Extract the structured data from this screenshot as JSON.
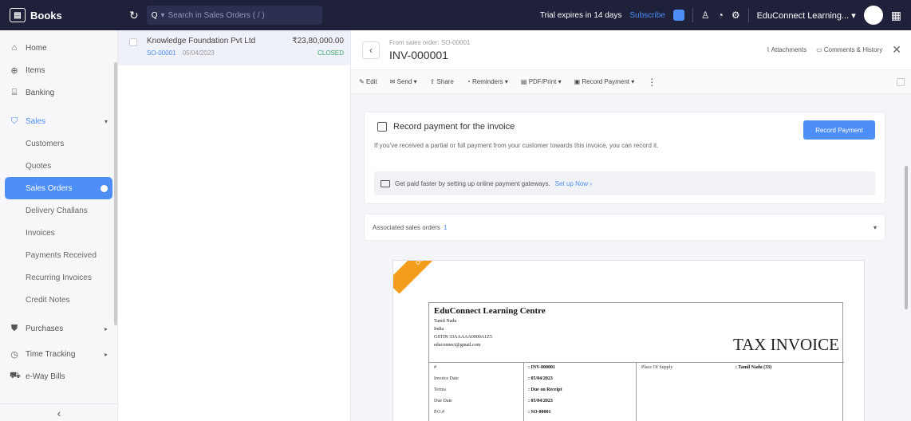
{
  "topbar": {
    "brand": "Books",
    "search_scope": "Q",
    "search_placeholder": "Search in Sales Orders ( / )",
    "trial_text": "Trial expires in 14 days",
    "subscribe": "Subscribe",
    "org_name": "EduConnect Learning..."
  },
  "sidebar": {
    "items": [
      {
        "label": "Home"
      },
      {
        "label": "Items"
      },
      {
        "label": "Banking"
      }
    ],
    "sales": {
      "label": "Sales"
    },
    "sales_sub": [
      {
        "label": "Customers"
      },
      {
        "label": "Quotes"
      },
      {
        "label": "Sales Orders"
      },
      {
        "label": "Delivery Challans"
      },
      {
        "label": "Invoices"
      },
      {
        "label": "Payments Received"
      },
      {
        "label": "Recurring Invoices"
      },
      {
        "label": "Credit Notes"
      }
    ],
    "bottom": [
      {
        "label": "Purchases"
      },
      {
        "label": "Time Tracking"
      },
      {
        "label": "e-Way Bills"
      }
    ]
  },
  "list": {
    "rows": [
      {
        "name": "Knowledge Foundation Pvt Ltd",
        "order_no": "SO-00001",
        "date": "05/04/2023",
        "amount": "₹23,80,000.00",
        "status": "CLOSED"
      }
    ]
  },
  "detail": {
    "from_so": "From sales order: SO-00001",
    "invoice_no": "INV-000001",
    "attachments": "Attachments",
    "comments": "Comments & History",
    "toolbar": {
      "edit": "Edit",
      "send": "Send ▾",
      "share": "Share",
      "reminders": "Reminders ▾",
      "pdf_print": "PDF/Print ▾",
      "record_payment": "Record Payment ▾"
    },
    "pay_card": {
      "title": "Record payment for the invoice",
      "desc": "If you've received a partial or full payment from your customer towards this invoice, you can record it.",
      "button": "Record Payment",
      "gateway_text": "Get paid faster by setting up online payment gateways.",
      "gateway_link": "Set up Now ›"
    },
    "associated": {
      "label": "Associated sales orders",
      "count": "1"
    }
  },
  "invoice_doc": {
    "ribbon": "Overdue",
    "org_name": "EduConnect Learning Centre",
    "org_lines": [
      "Tamil Nadu",
      "India",
      "GSTIN 33AAAAA0000A1Z5",
      "educonnect@gmail.com"
    ],
    "title": "TAX INVOICE",
    "fields": [
      {
        "label": "#",
        "value": ": INV-000001"
      },
      {
        "label": "Invoice Date",
        "value": ": 05/04/2023"
      },
      {
        "label": "Terms",
        "value": ": Due on Receipt"
      },
      {
        "label": "Due Date",
        "value": ": 05/04/2023"
      },
      {
        "label": "P.O.#",
        "value": ": SO-00001"
      }
    ],
    "place_label": "Place Of Supply",
    "place_value": ": Tamil Nadu (33)"
  }
}
